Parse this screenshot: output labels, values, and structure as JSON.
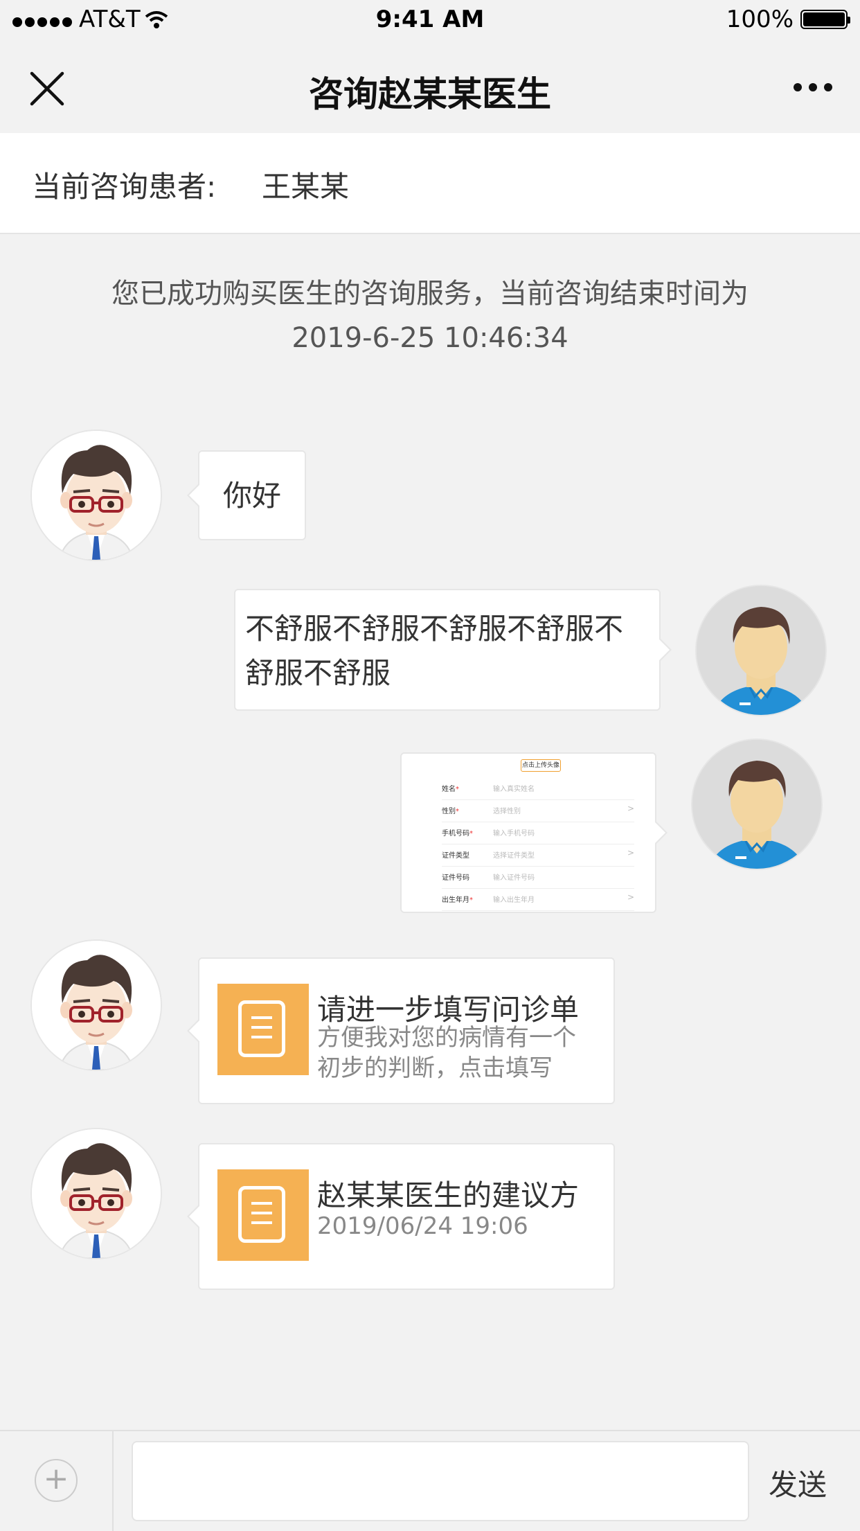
{
  "status_bar": {
    "carrier": "AT&T",
    "time": "9:41 AM",
    "battery": "100%"
  },
  "nav": {
    "title": "咨询赵某某医生"
  },
  "patient_bar": {
    "label": "当前咨询患者:",
    "name": "王某某"
  },
  "notice": {
    "line1": "您已成功购买医生的咨询服务，当前咨询结束时间为",
    "line2": "2019-6-25   10:46:34"
  },
  "messages": [
    {
      "text": "你好"
    },
    {
      "line1": "不舒服不舒服不舒服不舒服不",
      "line2": "舒服不舒服"
    },
    {
      "form_image": {
        "upload": "点击上传头像",
        "rows": [
          {
            "label": "姓名",
            "required": "*",
            "value": "输入真实姓名",
            "chevron": ""
          },
          {
            "label": "性别",
            "required": "*",
            "value": "选择性别",
            "chevron": ">"
          },
          {
            "label": "手机号码",
            "required": "*",
            "value": "输入手机号码",
            "chevron": ""
          },
          {
            "label": "证件类型",
            "required": "",
            "value": "选择证件类型",
            "chevron": ">"
          },
          {
            "label": "证件号码",
            "required": "",
            "value": "输入证件号码",
            "chevron": ""
          },
          {
            "label": "出生年月",
            "required": "*",
            "value": "输入出生年月",
            "chevron": ">"
          }
        ]
      }
    },
    {
      "title": "请进一步填写问诊单",
      "sub1": "方便我对您的病情有一个",
      "sub2": "初步的判断，点击填写"
    },
    {
      "title": "赵某某医生的建议方",
      "sub": "2019/06/24 19:06"
    }
  ],
  "bottom_bar": {
    "plus": "+",
    "send": "发送"
  },
  "colors": {
    "accent_orange": "#f5b153",
    "background": "#f2f2f2"
  }
}
